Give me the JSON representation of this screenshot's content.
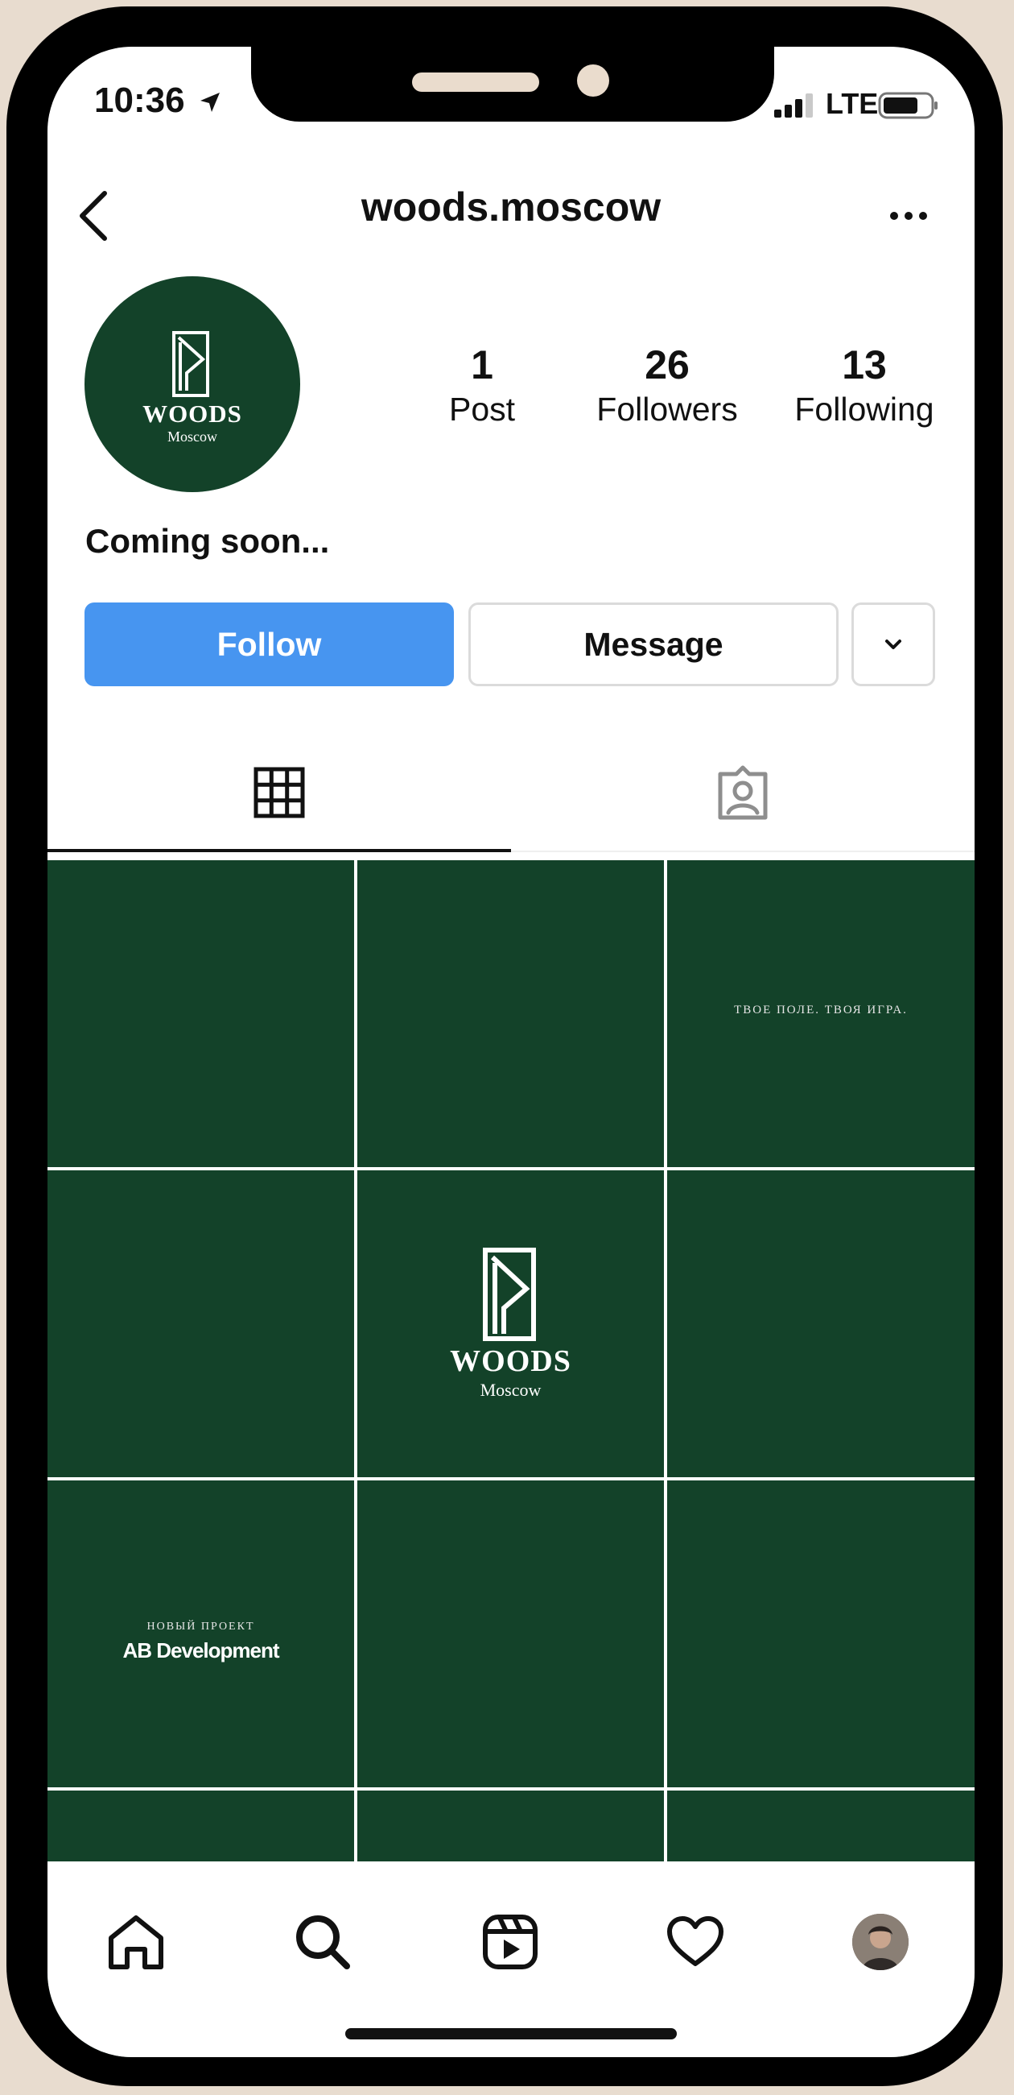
{
  "status_bar": {
    "time": "10:36",
    "network": "LTE"
  },
  "header": {
    "username": "woods.moscow"
  },
  "profile": {
    "avatar_logo_text": "WOODS",
    "avatar_logo_subtext": "Moscow",
    "stats": [
      {
        "value": "1",
        "label": "Post"
      },
      {
        "value": "26",
        "label": "Followers"
      },
      {
        "value": "13",
        "label": "Following"
      }
    ],
    "bio": "Coming soon..."
  },
  "actions": {
    "follow_label": "Follow",
    "message_label": "Message"
  },
  "grid_posts": {
    "quote": "ТВОЕ ПОЛЕ. ТВОЯ ИГРА.",
    "logo_text": "WOODS",
    "logo_subtext": "Moscow",
    "project_subtitle": "НОВЫЙ ПРОЕКТ",
    "project_title": "AB Development"
  },
  "colors": {
    "brand_green": "#134229",
    "follow_blue": "#4795f0"
  },
  "icons": [
    "back-icon",
    "more-icon",
    "grid-icon",
    "tagged-icon",
    "home-icon",
    "search-icon",
    "reels-icon",
    "heart-icon"
  ]
}
